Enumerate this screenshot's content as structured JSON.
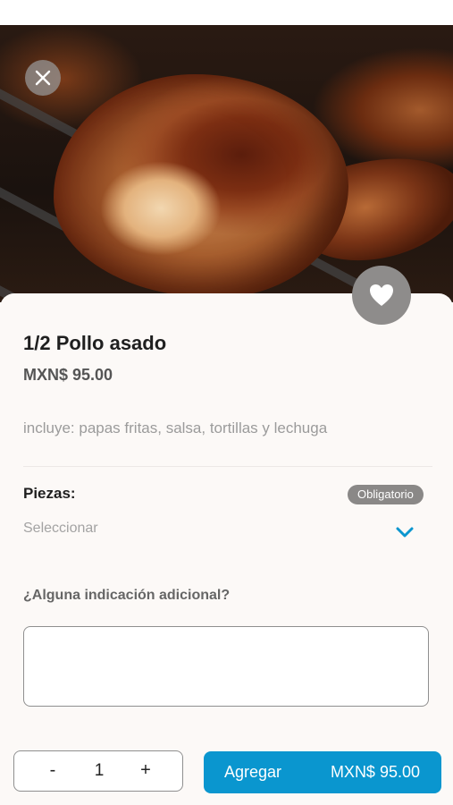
{
  "product": {
    "name": "1/2 Pollo asado",
    "price": "MXN$ 95.00",
    "description": "incluye: papas fritas, salsa, tortillas y lechuga"
  },
  "options": {
    "pieces_label": "Piezas:",
    "required_badge": "Obligatorio",
    "select_placeholder": "Seleccionar"
  },
  "notes": {
    "label": "¿Alguna indicación adicional?",
    "value": ""
  },
  "quantity": {
    "minus": "-",
    "value": "1",
    "plus": "+"
  },
  "cart": {
    "add_label": "Agregar",
    "total": "MXN$ 95.00"
  },
  "icons": {
    "close": "close-icon",
    "favorite": "heart-icon",
    "dropdown": "chevron-down-icon"
  },
  "colors": {
    "accent": "#0a96cf",
    "badge": "#8a8887",
    "sheet": "#fcf9f7"
  }
}
